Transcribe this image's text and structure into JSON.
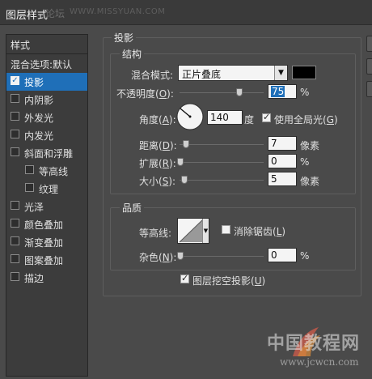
{
  "window": {
    "title": "图层样式",
    "watermark_cn": "论坛",
    "watermark_url": "WWW.MISSYUAN.COM"
  },
  "style_list": {
    "header": "样式",
    "items": [
      {
        "label": "混合选项:默认",
        "checkbox": false
      },
      {
        "label": "投影",
        "checkbox": true,
        "checked": true,
        "active": true
      },
      {
        "label": "内阴影",
        "checkbox": true,
        "checked": false
      },
      {
        "label": "外发光",
        "checkbox": true,
        "checked": false
      },
      {
        "label": "内发光",
        "checkbox": true,
        "checked": false
      },
      {
        "label": "斜面和浮雕",
        "checkbox": true,
        "checked": false
      },
      {
        "label": "等高线",
        "checkbox": true,
        "checked": false,
        "indent": true
      },
      {
        "label": "纹理",
        "checkbox": true,
        "checked": false,
        "indent": true
      },
      {
        "label": "光泽",
        "checkbox": true,
        "checked": false
      },
      {
        "label": "颜色叠加",
        "checkbox": true,
        "checked": false
      },
      {
        "label": "渐变叠加",
        "checkbox": true,
        "checked": false
      },
      {
        "label": "图案叠加",
        "checkbox": true,
        "checked": false
      },
      {
        "label": "描边",
        "checkbox": true,
        "checked": false
      }
    ]
  },
  "drop_shadow": {
    "section_title": "投影",
    "structure": {
      "title": "结构",
      "blend_mode_label": "混合模式:",
      "blend_mode_value": "正片叠底",
      "shadow_color": "#000000",
      "opacity_label": "不透明度(",
      "opacity_key": "O",
      "opacity_close": "):",
      "opacity_value": "75",
      "opacity_unit": "%",
      "angle_label": "角度(",
      "angle_key": "A",
      "angle_close": "):",
      "angle_value": "140",
      "angle_unit": "度",
      "global_light_label": "使用全局光(",
      "global_light_key": "G",
      "global_light_close": ")",
      "global_light_checked": true,
      "distance_label": "距离(",
      "distance_key": "D",
      "distance_close": "):",
      "distance_value": "7",
      "distance_unit": "像素",
      "spread_label": "扩展(",
      "spread_key": "R",
      "spread_close": "):",
      "spread_value": "0",
      "spread_unit": "%",
      "size_label": "大小(",
      "size_key": "S",
      "size_close": "):",
      "size_value": "5",
      "size_unit": "像素"
    },
    "quality": {
      "title": "品质",
      "contour_label": "等高线:",
      "anti_alias_label": "消除锯齿(",
      "anti_alias_key": "L",
      "anti_alias_close": ")",
      "anti_alias_checked": false,
      "noise_label": "杂色(",
      "noise_key": "N",
      "noise_close": "):",
      "noise_value": "0",
      "noise_unit": "%"
    },
    "knockout_label": "图层挖空投影(",
    "knockout_key": "U",
    "knockout_close": ")",
    "knockout_checked": true
  },
  "footer_watermark": {
    "cn": "中国教程网",
    "url": "www.jcwcn.com"
  },
  "colors": {
    "accent": "#1f6fb8",
    "panel": "#4a4a4a"
  }
}
